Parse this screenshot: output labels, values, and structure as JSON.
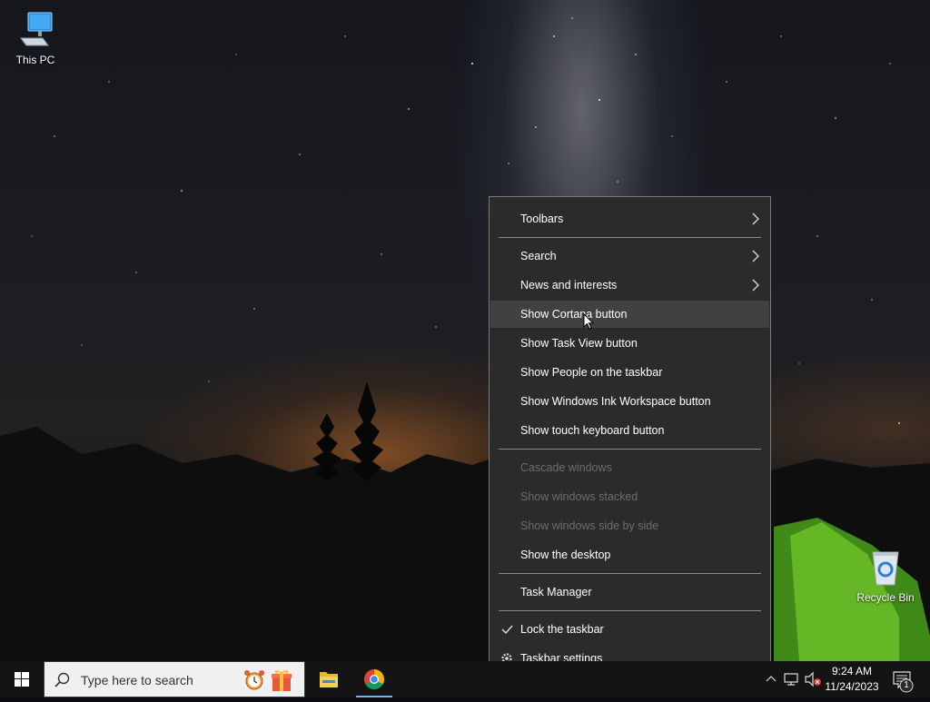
{
  "desktop": {
    "icons": [
      {
        "label": "This PC",
        "icon": "monitor-icon"
      },
      {
        "label": "Recycle Bin",
        "icon": "recycle-bin-icon"
      }
    ]
  },
  "context_menu": {
    "items": [
      {
        "label": "Toolbars",
        "submenu": true,
        "enabled": true
      },
      {
        "label": "Search",
        "submenu": true,
        "enabled": true
      },
      {
        "label": "News and interests",
        "submenu": true,
        "enabled": true
      },
      {
        "label": "Show Cortana button",
        "enabled": true,
        "hovered": true
      },
      {
        "label": "Show Task View button",
        "enabled": true
      },
      {
        "label": "Show People on the taskbar",
        "enabled": true
      },
      {
        "label": "Show Windows Ink Workspace button",
        "enabled": true
      },
      {
        "label": "Show touch keyboard button",
        "enabled": true
      },
      {
        "label": "Cascade windows",
        "enabled": false
      },
      {
        "label": "Show windows stacked",
        "enabled": false
      },
      {
        "label": "Show windows side by side",
        "enabled": false
      },
      {
        "label": "Show the desktop",
        "enabled": true
      },
      {
        "label": "Task Manager",
        "enabled": true
      },
      {
        "label": "Lock the taskbar",
        "enabled": true,
        "checked": true
      },
      {
        "label": "Taskbar settings",
        "enabled": true,
        "icon": "gear-icon"
      }
    ]
  },
  "taskbar": {
    "search_placeholder": "Type here to search",
    "apps": [
      {
        "name": "File Explorer",
        "icon": "folder-icon"
      },
      {
        "name": "Google Chrome",
        "icon": "chrome-icon",
        "active": true
      }
    ],
    "tray": {
      "time": "9:24 AM",
      "date": "11/24/2023",
      "notification_count": "1"
    }
  },
  "colors": {
    "menu_bg": "#2b2b2b",
    "menu_hover": "#414141",
    "menu_disabled_text": "#6d6d6d",
    "taskbar_bg": "#141414",
    "accent": "#7db3e8"
  }
}
